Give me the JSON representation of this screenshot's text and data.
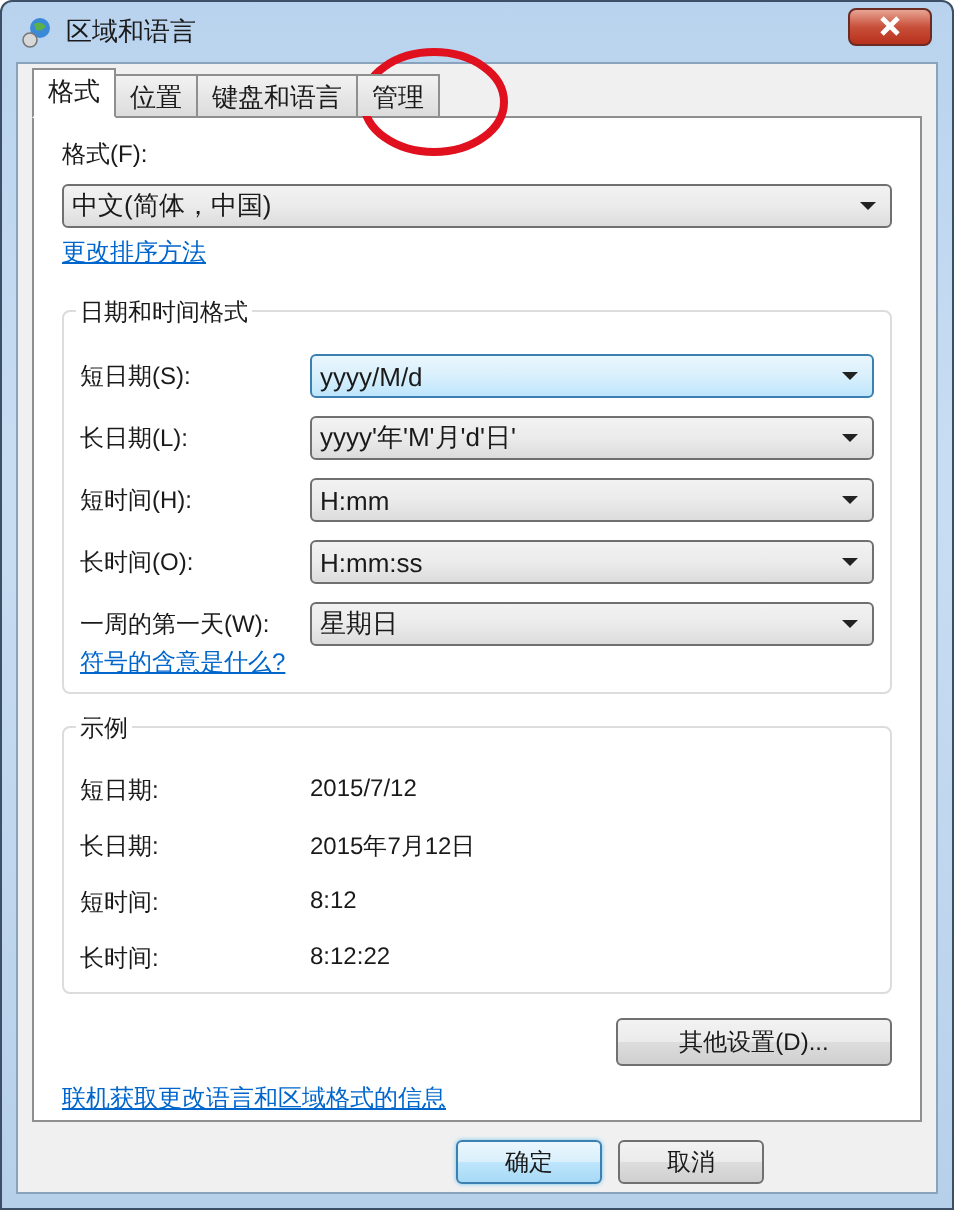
{
  "window": {
    "title": "区域和语言"
  },
  "tabs": [
    {
      "label": "格式",
      "selected": true
    },
    {
      "label": "位置",
      "selected": false
    },
    {
      "label": "键盘和语言",
      "selected": false
    },
    {
      "label": "管理",
      "selected": false
    }
  ],
  "format": {
    "label": "格式(F):",
    "value": "中文(简体，中国)"
  },
  "sort_link": "更改排序方法",
  "datetime_group": {
    "title": "日期和时间格式",
    "rows": [
      {
        "label": "短日期(S):",
        "value": "yyyy/M/d",
        "focused": true
      },
      {
        "label": "长日期(L):",
        "value": "yyyy'年'M'月'd'日'",
        "focused": false
      },
      {
        "label": "短时间(H):",
        "value": "H:mm",
        "focused": false
      },
      {
        "label": "长时间(O):",
        "value": "H:mm:ss",
        "focused": false
      },
      {
        "label": "一周的第一天(W):",
        "value": "星期日",
        "focused": false
      }
    ]
  },
  "symbol_link": "符号的含意是什么?",
  "examples": {
    "title": "示例",
    "rows": [
      {
        "label": "短日期:",
        "value": "2015/7/12"
      },
      {
        "label": "长日期:",
        "value": "2015年7月12日"
      },
      {
        "label": "短时间:",
        "value": "8:12"
      },
      {
        "label": "长时间:",
        "value": "8:12:22"
      }
    ]
  },
  "other_settings_button": "其他设置(D)...",
  "online_link": "联机获取更改语言和区域格式的信息",
  "buttons": [
    {
      "label": "确定",
      "default": true
    },
    {
      "label": "取消",
      "default": false
    }
  ]
}
